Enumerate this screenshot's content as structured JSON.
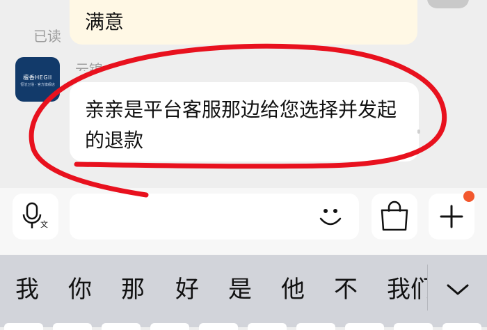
{
  "chat": {
    "prev_message": "满意",
    "read_status": "已读",
    "sender_name": "云锦",
    "message": "亲亲是平台客服那边给您选择并发起的退款",
    "avatar_logo": "檀香HEGII",
    "avatar_sub": "恒洁卫浴 · 官方旗舰店"
  },
  "input_bar": {
    "voice_icon": "microphone-text-icon",
    "emoji_icon": "smiley-face-icon",
    "bag_icon": "shopping-bag-icon",
    "plus_icon": "plus-icon",
    "plus_badge_color": "#f2572d",
    "input_value": ""
  },
  "keyboard": {
    "candidates": [
      "我",
      "你",
      "那",
      "好",
      "是",
      "他",
      "不",
      "我们"
    ],
    "expand_icon": "chevron-down-icon"
  },
  "colors": {
    "annotation_circle": "#e8111e",
    "received_bubble": "#ffffff",
    "sent_bubble": "#fff8e5",
    "background": "#eeeeee"
  }
}
